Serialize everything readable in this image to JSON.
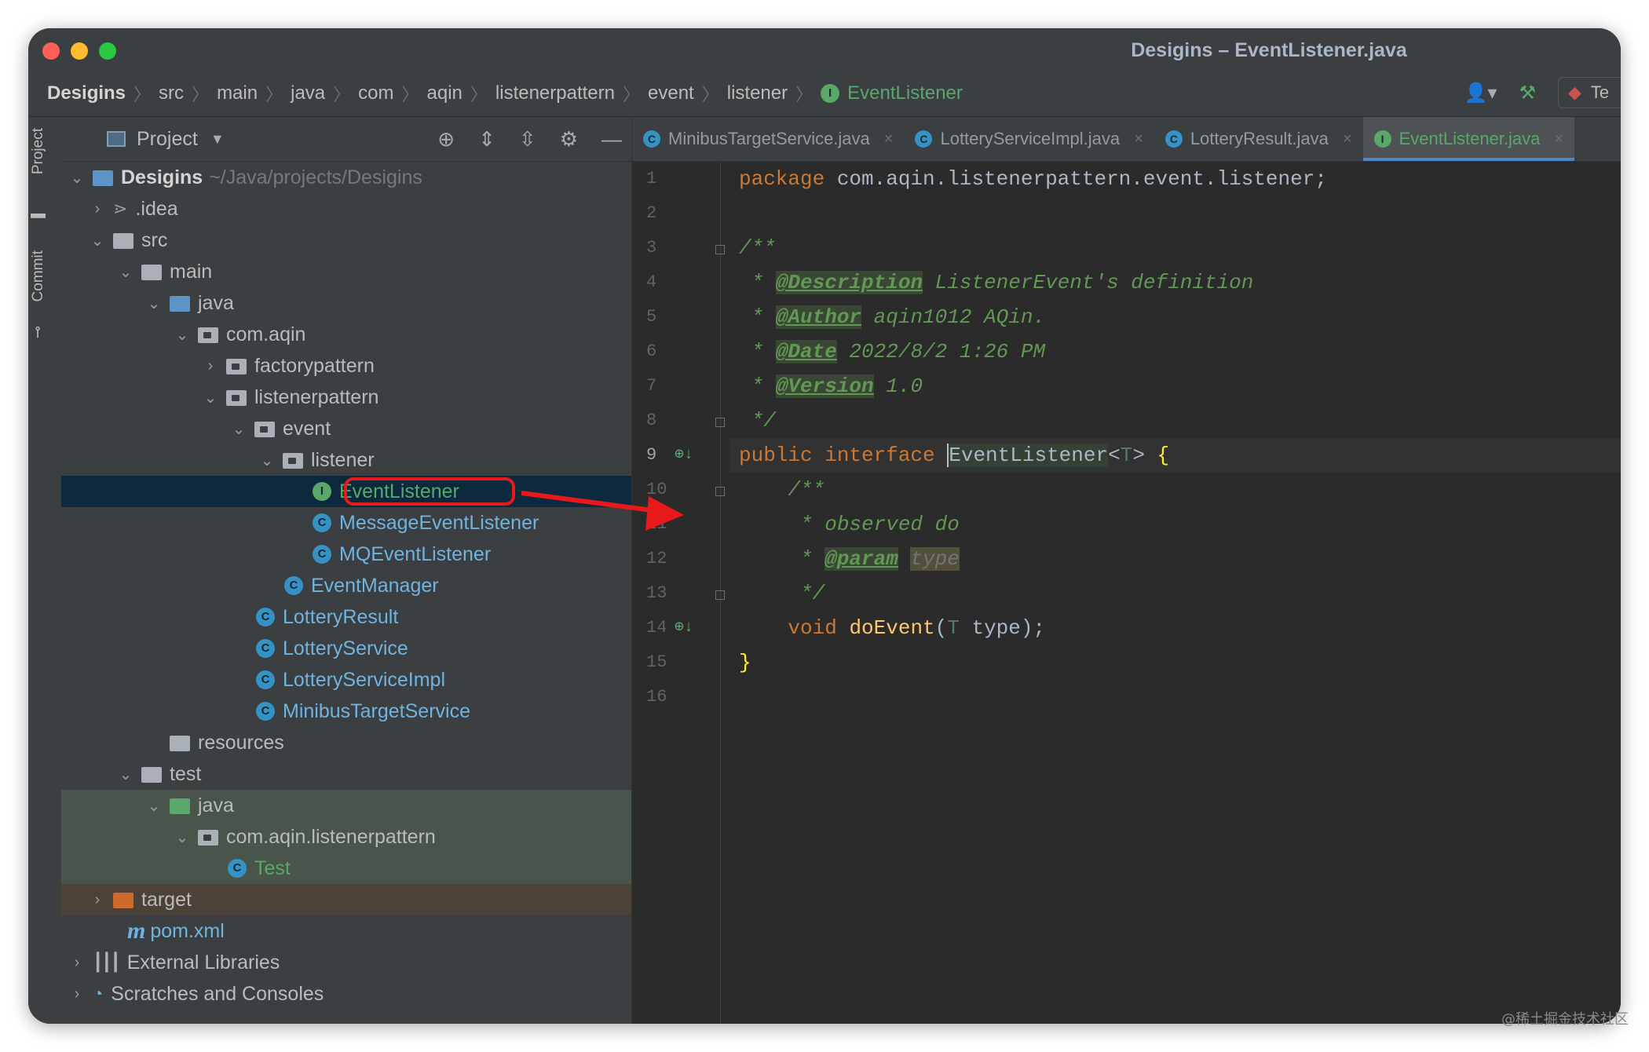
{
  "window": {
    "title": "Desigins – EventListener.java"
  },
  "breadcrumb": {
    "items": [
      "Desigins",
      "src",
      "main",
      "java",
      "com",
      "aqin",
      "listenerpattern",
      "event",
      "listener"
    ],
    "current": "EventListener"
  },
  "toolbar": {
    "run_config_label": "Te"
  },
  "strip": {
    "project_label": "Project",
    "commit_label": "Commit"
  },
  "project_panel": {
    "title": "Project",
    "tree": [
      {
        "label": "Desigins",
        "path": "~/Java/projects/Desigins"
      },
      {
        "label": ".idea"
      },
      {
        "label": "src"
      },
      {
        "label": "main"
      },
      {
        "label": "java"
      },
      {
        "label": "com.aqin"
      },
      {
        "label": "factorypattern"
      },
      {
        "label": "listenerpattern"
      },
      {
        "label": "event"
      },
      {
        "label": "listener"
      },
      {
        "label": "EventListener",
        "kind": "interface",
        "icon": "I"
      },
      {
        "label": "MessageEventListener",
        "kind": "class",
        "icon": "C"
      },
      {
        "label": "MQEventListener",
        "kind": "class",
        "icon": "C"
      },
      {
        "label": "EventManager",
        "kind": "class",
        "icon": "C"
      },
      {
        "label": "LotteryResult",
        "kind": "class",
        "icon": "C"
      },
      {
        "label": "LotteryService",
        "kind": "class",
        "icon": "C"
      },
      {
        "label": "LotteryServiceImpl",
        "kind": "class",
        "icon": "C"
      },
      {
        "label": "MinibusTargetService",
        "kind": "class",
        "icon": "C"
      },
      {
        "label": "resources"
      },
      {
        "label": "test"
      },
      {
        "label": "java"
      },
      {
        "label": "com.aqin.listenerpattern"
      },
      {
        "label": "Test",
        "kind": "class",
        "icon": "C"
      },
      {
        "label": "target"
      },
      {
        "label": "pom.xml"
      },
      {
        "label": "External Libraries"
      },
      {
        "label": "Scratches and Consoles"
      }
    ]
  },
  "editor": {
    "tabs": [
      {
        "label": "MinibusTargetService.java",
        "icon": "C",
        "active": false
      },
      {
        "label": "LotteryServiceImpl.java",
        "icon": "C",
        "active": false
      },
      {
        "label": "LotteryResult.java",
        "icon": "C",
        "active": false
      },
      {
        "label": "EventListener.java",
        "icon": "I",
        "active": true
      }
    ],
    "line_numbers": [
      "1",
      "2",
      "3",
      "4",
      "5",
      "6",
      "7",
      "8",
      "9",
      "10",
      "11",
      "12",
      "13",
      "14",
      "15",
      "16"
    ],
    "code": {
      "l1_kw": "package",
      "l1_rest": " com.aqin.listenerpattern.event.listener;",
      "l3": "/**",
      "l4_star": " * ",
      "l4_tag": "@Description",
      "l4_text": " ListenerEvent's definition",
      "l5_star": " * ",
      "l5_tag": "@Author",
      "l5_text": " aqin1012 AQin.",
      "l6_star": " * ",
      "l6_tag": "@Date",
      "l6_text": " 2022/8/2 1:26 PM",
      "l7_star": " * ",
      "l7_tag": "@Version",
      "l7_text": " 1.0",
      "l8": " */",
      "l9_kw": "public interface ",
      "l9_name": "EventListener",
      "l9_lt": "<",
      "l9_tp": "T",
      "l9_gt": "> ",
      "l9_brace": "{",
      "l10": "    /**",
      "l11": "     * observed do",
      "l12_star": "     * ",
      "l12_tag": "@param",
      "l12_sp": " ",
      "l12_param": "type",
      "l13": "     */",
      "l14_indent": "    ",
      "l14_kw": "void ",
      "l14_fn": "doEvent",
      "l14_open": "(",
      "l14_tp": "T",
      "l14_rest": " type);",
      "l15": "}"
    }
  },
  "watermark": "@稀土掘金技术社区",
  "colors": {
    "selection_outline": "#e8191b",
    "arrow": "#e8191b",
    "interface_green": "#59a869",
    "class_blue": "#3592c4"
  }
}
